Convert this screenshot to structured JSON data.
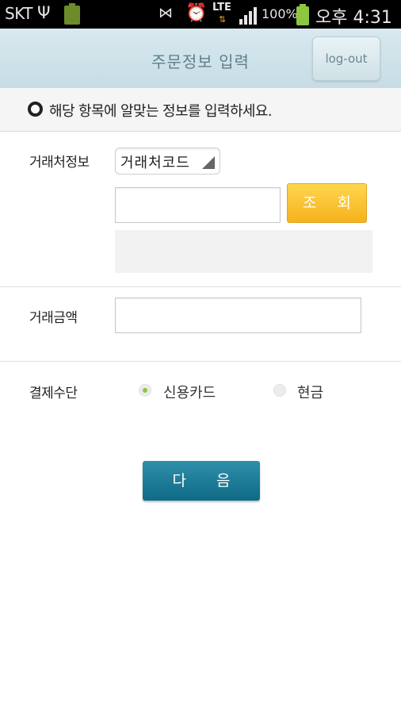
{
  "status_bar": {
    "carrier": "SKT",
    "lte": "LTE",
    "battery_percent": "100%",
    "time": "오후 4:31"
  },
  "header": {
    "title": "주문정보 입력",
    "logout_label": "log-out"
  },
  "info": {
    "message": "해당 항목에 알맞는 정보를 입력하세요."
  },
  "form": {
    "client_info_label": "거래처정보",
    "client_select_value": "거래처코드",
    "client_code_value": "",
    "lookup_label": "조 회",
    "amount_label": "거래금액",
    "amount_value": "",
    "payment_label": "결제수단",
    "payment_options": [
      {
        "label": "신용카드",
        "selected": true
      },
      {
        "label": "현금",
        "selected": false
      }
    ]
  },
  "actions": {
    "next_label": "다 음"
  },
  "colors": {
    "header_bg": "#c7dce4",
    "lookup_button": "#f5b21c",
    "next_button": "#0f6a86",
    "radio_selected": "#8cc63f"
  }
}
